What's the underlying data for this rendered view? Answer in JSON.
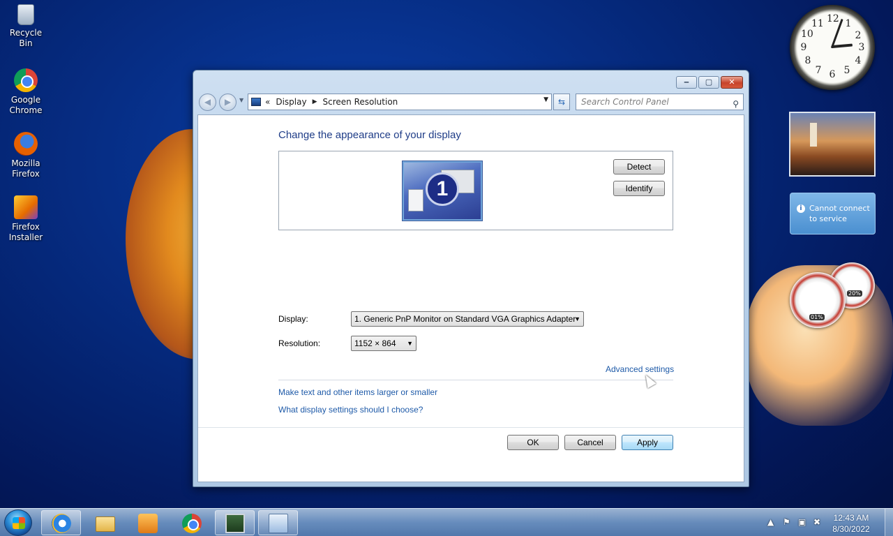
{
  "desktop": {
    "icons": [
      {
        "label": "Recycle Bin",
        "icon": "recycle-bin-icon"
      },
      {
        "label": "Google Chrome",
        "icon": "chrome-icon"
      },
      {
        "label": "Mozilla Firefox",
        "icon": "firefox-icon"
      },
      {
        "label": "Firefox Installer",
        "icon": "firefox-installer-icon"
      }
    ]
  },
  "gadgets": {
    "clock_numbers": [
      "12",
      "1",
      "2",
      "3",
      "4",
      "5",
      "6",
      "7",
      "8",
      "9",
      "10",
      "11"
    ],
    "weather_text": "Cannot connect to service",
    "cpu_meter": "01%",
    "memory_meter": "20%"
  },
  "window": {
    "controls": {
      "minimize": "‒",
      "maximize": "▢",
      "close": "✕"
    },
    "breadcrumb": {
      "overflow": "«",
      "items": [
        "Display",
        "Screen Resolution"
      ]
    },
    "search_placeholder": "Search Control Panel",
    "content": {
      "title": "Change the appearance of your display",
      "monitor_number": "1",
      "detect_label": "Detect",
      "identify_label": "Identify",
      "display_label": "Display:",
      "display_value": "1. Generic PnP Monitor on Standard VGA Graphics Adapter",
      "resolution_label": "Resolution:",
      "resolution_value": "1152 × 864",
      "advanced_link": "Advanced settings",
      "link_text_size": "Make text and other items larger or smaller",
      "link_display_help": "What display settings should I choose?",
      "ok_label": "OK",
      "cancel_label": "Cancel",
      "apply_label": "Apply"
    }
  },
  "taskbar": {
    "items": [
      "internet-explorer-icon",
      "windows-explorer-icon",
      "media-player-icon",
      "chrome-icon",
      "task-manager-icon",
      "control-panel-icon"
    ],
    "time": "12:43 AM",
    "date": "8/30/2022"
  },
  "colors": {
    "title_blue": "#1e3c87",
    "link_blue": "#1e5aa8"
  }
}
